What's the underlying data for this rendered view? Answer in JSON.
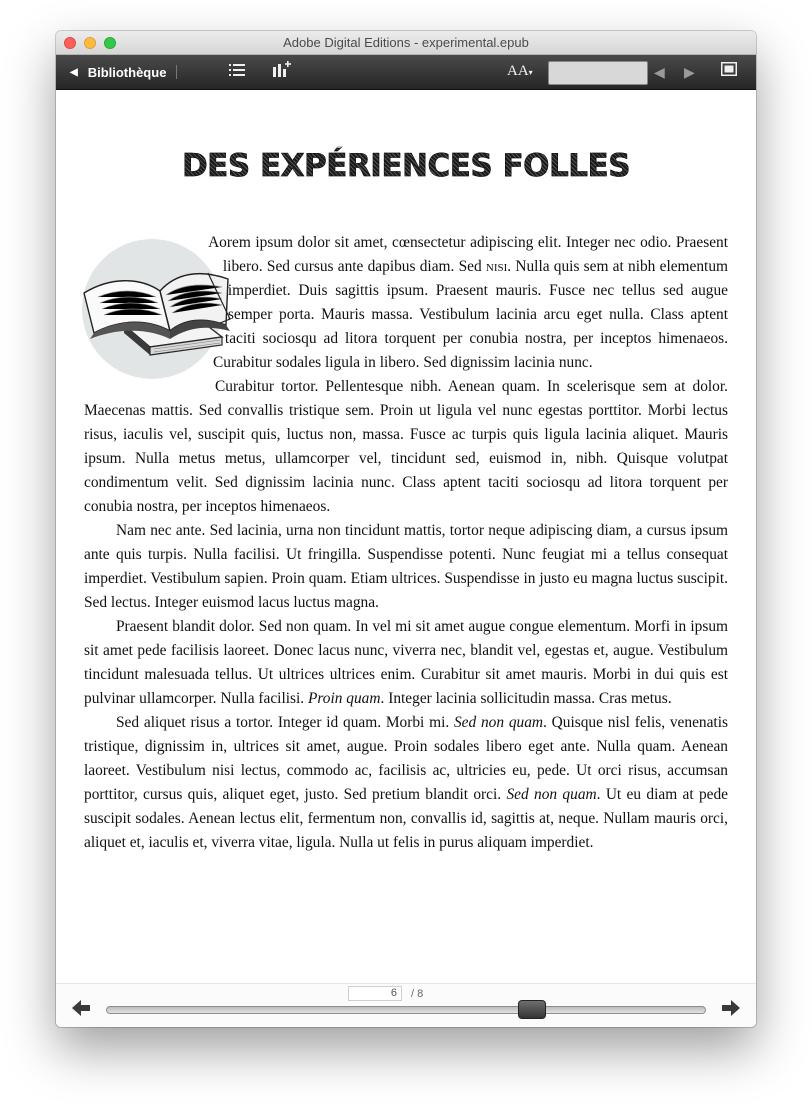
{
  "window": {
    "title": "Adobe Digital Editions - experimental.epub"
  },
  "toolbar": {
    "back_label": "Bibliothèque",
    "list_icon": "list-icon",
    "bookmark_icon": "bookmark-add-icon",
    "font_size_label": "AA",
    "search_value": "",
    "fullscreen_icon": "fullscreen-icon"
  },
  "book": {
    "title": "DES EXPÉRIENCES FOLLES",
    "image_icon": "open-books-illustration",
    "paragraphs": [
      {
        "before": "Aorem ipsum dolor sit amet, cœnsectetur adipiscing elit. Integer nec odio. Praesent libero. Sed cursus ante dapibus diam. Sed ",
        "smallcaps": "nisi",
        "after": ". Nulla quis sem at nibh elementum imperdiet. Duis sagittis ipsum. Praesent mauris. Fusce nec tellus sed augue semper porta. Mauris massa. Vestibulum lacinia arcu eget nulla. Class aptent taciti sociosqu ad litora torquent per conubia nostra, per inceptos himenaeos. Curabitur sodales ligula in libero. Sed dignissim lacinia nunc."
      },
      {
        "text": "Curabitur tortor. Pellentesque nibh. Aenean quam. In scelerisque sem at dolor. Maecenas mattis. Sed convallis tristique sem. Proin ut ligula vel nunc egestas porttitor. Morbi lectus risus, iaculis vel, suscipit quis, luctus non, massa. Fusce ac turpis quis ligula lacinia aliquet. Mauris ipsum. Nulla metus metus, ullamcorper vel, tincidunt sed, euismod in, nibh. Quisque volutpat condimentum velit. Sed dignissim lacinia nunc. Class aptent taciti sociosqu ad litora torquent per conubia nostra, per inceptos himenaeos."
      },
      {
        "text": "Nam nec ante. Sed lacinia, urna non tincidunt mattis, tortor neque adipiscing diam, a cursus ipsum ante quis turpis. Nulla facilisi. Ut fringilla. Suspendisse potenti. Nunc feugiat mi a tellus consequat imperdiet. Vestibulum sapien. Proin quam. Etiam ultrices. Suspendisse in justo eu magna luctus suscipit. Sed lectus. Integer euismod lacus luctus magna."
      },
      {
        "before": "Praesent blandit dolor. Sed non quam. In vel mi sit amet augue congue elementum. Morfi in ipsum sit amet pede facilisis laoreet. Donec lacus nunc, viverra nec, blandit vel, egestas et, augue. Vestibulum tincidunt malesuada tellus. Ut ultrices ultrices enim. Curabitur sit amet mauris. Morbi in dui quis est pulvinar ullamcorper. Nulla facilisi. ",
        "italic": "Proin quam",
        "after": ". Integer lacinia sollicitudin massa. Cras metus."
      },
      {
        "before": "Sed aliquet risus a tortor. Integer id quam. Morbi mi. ",
        "italic": "Sed non quam",
        "middle": ". Quisque nisl felis, venenatis tristique, dignissim in, ultrices sit amet, augue. Proin sodales libero eget ante. Nulla quam. Aenean laoreet. Vestibulum nisi lectus, commodo ac, facilisis ac, ultricies eu, pede. Ut orci risus, accumsan porttitor, cursus quis, aliquet eget, justo. Sed pretium blandit orci. ",
        "italic2": "Sed non quam",
        "after": ". Ut eu diam at pede suscipit sodales. Aenean lectus elit, fermentum non, convallis id, sagittis at, neque. Nullam mauris orci, aliquet et, iaculis et, viverra vitae, ligula. Nulla ut felis in purus aliquam imperdiet."
      }
    ]
  },
  "status": {
    "current_page": "6",
    "total_pages": "/ 8",
    "progress_fraction": 0.72,
    "prev_icon": "arrow-left-icon",
    "next_icon": "arrow-right-icon"
  },
  "colors": {
    "toolbar_bg": "#2f2f2f",
    "close": "#fc605c",
    "minimize": "#fdbc40",
    "maximize": "#34c84a"
  }
}
